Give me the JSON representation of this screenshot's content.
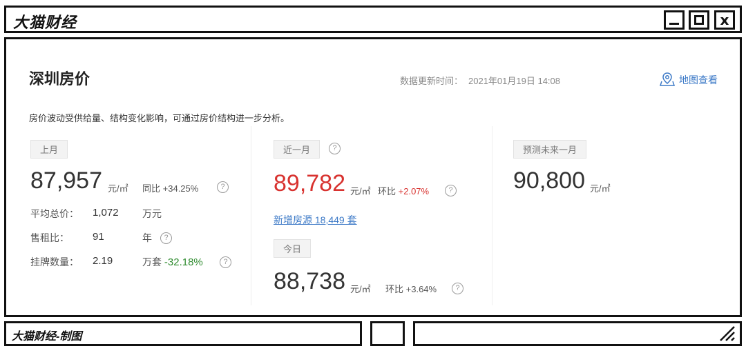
{
  "window": {
    "title": "大猫财经",
    "close_glyph": "x"
  },
  "card": {
    "title": "深圳房价",
    "update_label": "数据更新时间：",
    "update_value": "2021年01月19日 14:08",
    "map_link": "地图查看",
    "description": "房价波动受供给量、结构变化影响，可通过房价结构进一步分析。"
  },
  "last_month": {
    "tag": "上月",
    "price": "87,957",
    "unit": "元/㎡",
    "yoy_label": "同比",
    "yoy_value": "+34.25%",
    "rows": [
      {
        "label": "平均总价：",
        "value": "1,072",
        "unit": "万元"
      },
      {
        "label": "售租比：",
        "value": "91",
        "unit": "年"
      },
      {
        "label": "挂牌数量：",
        "value": "2.19",
        "unit": "万套",
        "change": "-32.18%"
      }
    ]
  },
  "recent_month": {
    "tag": "近一月",
    "price": "89,782",
    "unit": "元/㎡",
    "mom_label": "环比",
    "mom_value": "+2.07%",
    "new_listings": "新增房源 18,449 套"
  },
  "today": {
    "tag": "今日",
    "price": "88,738",
    "unit": "元/㎡",
    "mom_label": "环比",
    "mom_value": "+3.64%"
  },
  "forecast": {
    "tag": "预测未来一月",
    "price": "90,800",
    "unit": "元/㎡"
  },
  "footer": {
    "credit": "大猫财经-制图"
  },
  "colors": {
    "red": "#d8322f",
    "green": "#2e8b2e",
    "link": "#3d7ac7"
  },
  "icons": [
    "window-minimize-icon",
    "window-maximize-icon",
    "window-close-icon",
    "map-pin-icon",
    "help-circle-icon",
    "resize-grip-icon"
  ]
}
